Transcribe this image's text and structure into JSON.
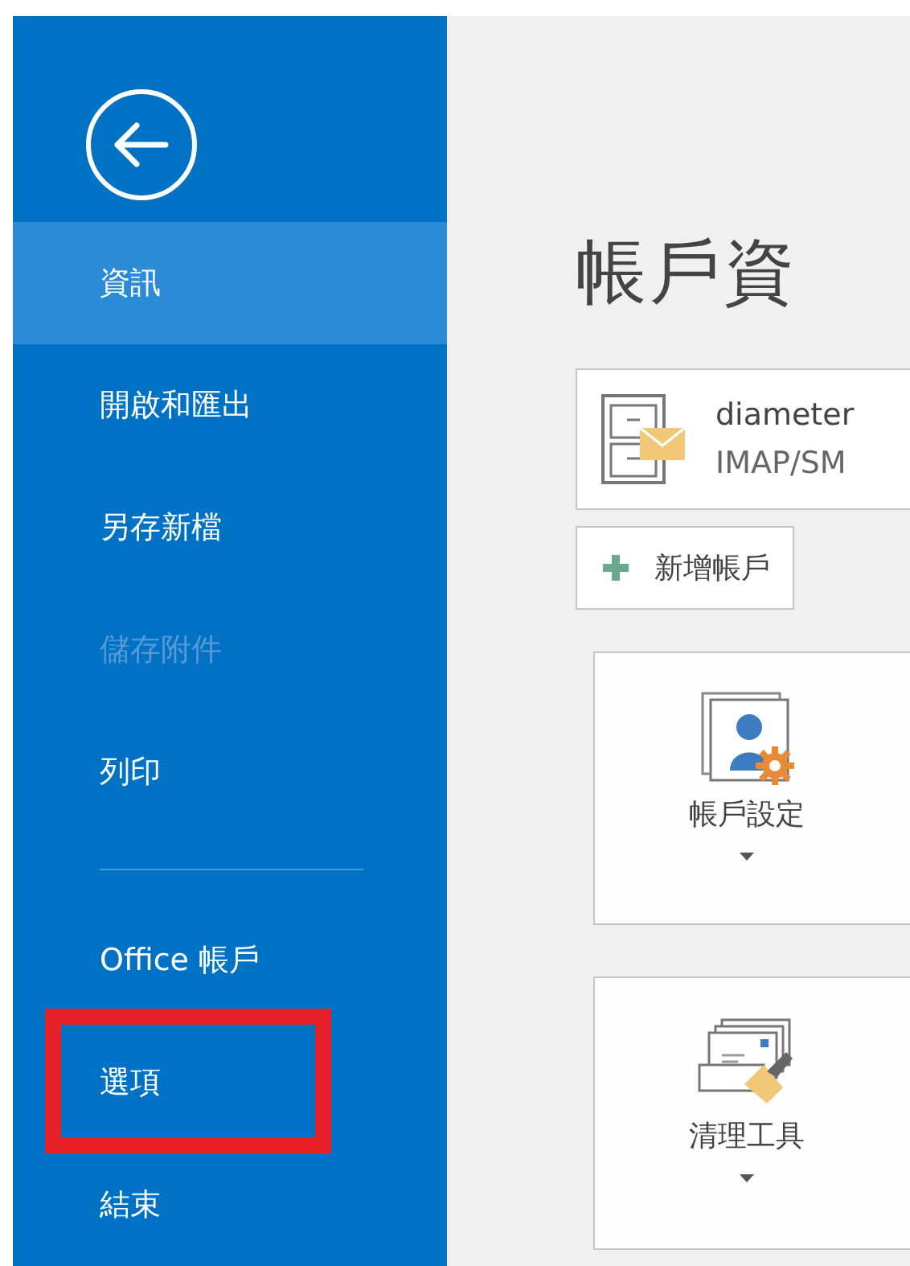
{
  "sidebar": {
    "sections": [
      {
        "items": [
          {
            "label": "資訊",
            "selected": true,
            "disabled": false,
            "highlighted": false
          },
          {
            "label": "開啟和匯出",
            "selected": false,
            "disabled": false,
            "highlighted": false
          },
          {
            "label": "另存新檔",
            "selected": false,
            "disabled": false,
            "highlighted": false
          },
          {
            "label": "儲存附件",
            "selected": false,
            "disabled": true,
            "highlighted": false
          },
          {
            "label": "列印",
            "selected": false,
            "disabled": false,
            "highlighted": false
          }
        ]
      },
      {
        "items": [
          {
            "label": "Office 帳戶",
            "selected": false,
            "disabled": false,
            "highlighted": false
          },
          {
            "label": "選項",
            "selected": false,
            "disabled": false,
            "highlighted": true
          },
          {
            "label": "結束",
            "selected": false,
            "disabled": false,
            "highlighted": false
          }
        ]
      }
    ]
  },
  "main": {
    "title": "帳戶資",
    "account": {
      "name": "diameter",
      "type": "IMAP/SM"
    },
    "add_account_button": "新增帳戶",
    "tools": [
      {
        "label": "帳戶設定",
        "kind": "account-settings"
      },
      {
        "label": "清理工具",
        "kind": "cleanup"
      }
    ]
  }
}
